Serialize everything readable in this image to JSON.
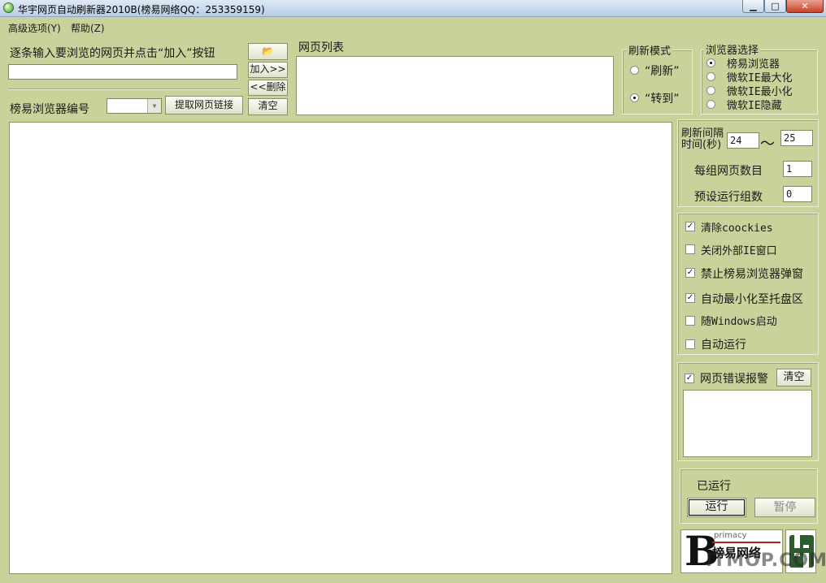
{
  "window": {
    "title": "华宇网页自动刷新器2010B(榜易网络QQ：253359159)",
    "min_glyph": "▁",
    "max_glyph": "□",
    "close_glyph": "✕"
  },
  "menu": [
    {
      "label": "高级选项(Y)"
    },
    {
      "label": "帮助(Z)"
    }
  ],
  "url_entry": {
    "instruction": "逐条输入要浏览的网页并点击“加入”按钮",
    "value": ""
  },
  "list_buttons": {
    "open_glyph": "📂",
    "add": "加入>>",
    "delete": "<<删除",
    "clear": "清空"
  },
  "browser_id": {
    "label": "榜易浏览器编号",
    "value": "",
    "extract_button": "提取网页链接"
  },
  "page_list": {
    "title": "网页列表"
  },
  "refresh_mode": {
    "title": "刷新模式",
    "options": [
      {
        "label": "“刷新”",
        "selected": false
      },
      {
        "label": "“转到”",
        "selected": true
      }
    ]
  },
  "browser_select": {
    "title": "浏览器选择",
    "options": [
      {
        "label": "榜易浏览器",
        "selected": true
      },
      {
        "label": "微软IE最大化",
        "selected": false
      },
      {
        "label": "微软IE最小化",
        "selected": false
      },
      {
        "label": "微软IE隐藏",
        "selected": false
      }
    ]
  },
  "interval": {
    "label_line1": "刷新间隔",
    "label_line2": "时间(秒)",
    "min": "24",
    "tilde": "～",
    "max": "25"
  },
  "group_count": {
    "label": "每组网页数目",
    "value": "1"
  },
  "preset_groups": {
    "label": "预设运行组数",
    "value": "0"
  },
  "options": [
    {
      "label": "清除coockies",
      "checked": true
    },
    {
      "label": "关闭外部IE窗口",
      "checked": false
    },
    {
      "label": "禁止榜易浏览器弹窗",
      "checked": true
    },
    {
      "label": "自动最小化至托盘区",
      "checked": true
    },
    {
      "label": "随Windows启动",
      "checked": false
    },
    {
      "label": "自动运行",
      "checked": false
    }
  ],
  "error_alert": {
    "label": "网页错误报警",
    "checked": true,
    "clear_button": "清空"
  },
  "run_panel": {
    "status": "已运行",
    "run_button": "运行",
    "pause_button": "暂停"
  },
  "logo": {
    "letter": "B",
    "tag": "primacy",
    "brand": "榜易网络",
    "watermark": "ITMOP.COM"
  },
  "colors": {
    "window_bg": "#c9d29a",
    "title_bg": "#b9cde5",
    "accent_red": "#c0201a"
  }
}
